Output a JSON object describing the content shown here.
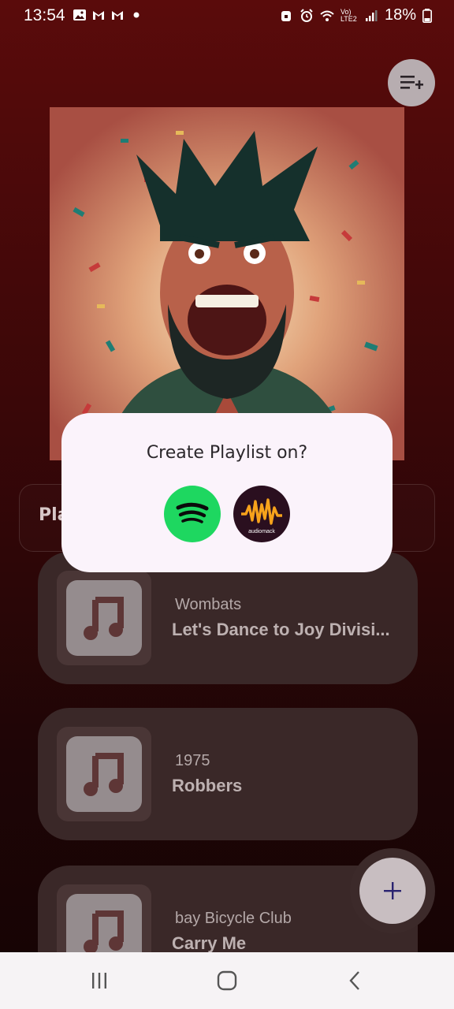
{
  "status_bar": {
    "time": "13:54",
    "left_icons": [
      "image-icon",
      "gmail-icon",
      "gmail-icon",
      "dot-icon"
    ],
    "right_icons": [
      "lock-icon",
      "alarm-icon",
      "wifi-icon",
      "volte-icon",
      "signal-icon"
    ],
    "volte_label": "Vo) LTE2",
    "battery": "18%"
  },
  "header": {
    "add_playlist_icon": "playlist-add-icon"
  },
  "tab_strip": {
    "visible_label": "Pla"
  },
  "tracks": [
    {
      "artist": "Wombats",
      "title": "Let's Dance to Joy Divisi..."
    },
    {
      "artist": "1975",
      "title": "Robbers"
    },
    {
      "artist": "bay Bicycle Club",
      "title": "Carry Me"
    }
  ],
  "dialog": {
    "title": "Create Playlist on?",
    "services": [
      {
        "name": "spotify-icon",
        "color": "#1ed760"
      },
      {
        "name": "audiomack-icon",
        "color": "#2a0f1f",
        "wordmark": "audiomack"
      }
    ]
  },
  "fab": {
    "icon": "plus-icon"
  },
  "nav_bar": {
    "buttons": [
      "recent-apps-icon",
      "home-icon",
      "back-icon"
    ]
  },
  "colors": {
    "accent": "#1ed760",
    "background": "#3a0708"
  }
}
